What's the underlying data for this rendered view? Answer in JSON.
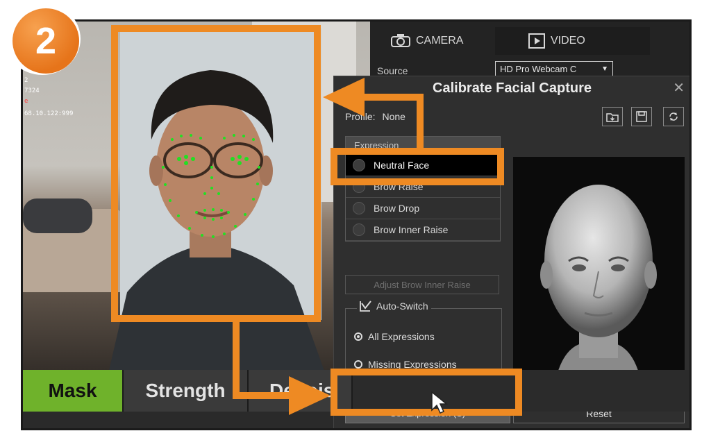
{
  "step_badge": "2",
  "camera_overlay": {
    "line1": "2",
    "line2": "7324",
    "line3": "e",
    "line4": "68.10.122:999"
  },
  "tabs": {
    "camera_label": "CAMERA",
    "video_label": "VIDEO"
  },
  "source": {
    "label": "Source",
    "value": "HD Pro Webcam C"
  },
  "dialog": {
    "title": "Calibrate Facial Capture",
    "profile_label": "Profile:",
    "profile_value": "None",
    "expression_header": "Expression",
    "expressions": [
      {
        "label": "Neutral Face",
        "selected": true
      },
      {
        "label": "Brow Raise",
        "selected": false
      },
      {
        "label": "Brow Drop",
        "selected": false
      },
      {
        "label": "Brow Inner Raise",
        "selected": false
      }
    ],
    "adjust_button": "Adjust Brow Inner Raise",
    "auto_switch_label": "Auto-Switch",
    "auto_switch_checked": true,
    "radio_options": [
      {
        "label": "All Expressions",
        "selected": true
      },
      {
        "label": "Missing Expressions",
        "selected": false
      }
    ],
    "set_expression_button": "Set Expression (S)",
    "reset_button": "Reset"
  },
  "bottom_toolbar": {
    "mask": "Mask",
    "strength": "Strength",
    "denoise": "Denois"
  },
  "colors": {
    "annotation_orange": "#ee8a23",
    "mask_green": "#6fb22b",
    "landmark_green": "#22e022"
  }
}
